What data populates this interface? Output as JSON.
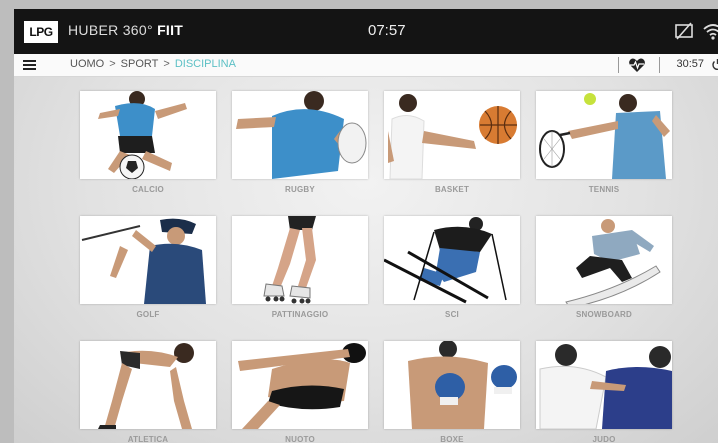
{
  "status_bar": {
    "logo": "LPG",
    "app_name_prefix": "HUBER 360°",
    "app_name_suffix": "FIIT",
    "clock": "07:57",
    "icons": [
      "no-screen-icon",
      "wifi-icon"
    ]
  },
  "nav": {
    "breadcrumb": [
      "UOMO",
      "SPORT",
      "DISCIPLINA"
    ],
    "separators": [
      ">",
      ">"
    ],
    "timer": "30:57",
    "icons": [
      "menu-icon",
      "heart-rate-icon",
      "power-icon"
    ],
    "accent_color": "#5cc0c5"
  },
  "sports": [
    {
      "id": "calcio",
      "label": "CALCIO",
      "icon": "football-player"
    },
    {
      "id": "rugby",
      "label": "RUGBY",
      "icon": "rugby-player"
    },
    {
      "id": "basket",
      "label": "BASKET",
      "icon": "basketball-player"
    },
    {
      "id": "tennis",
      "label": "TENNIS",
      "icon": "tennis-player"
    },
    {
      "id": "golf",
      "label": "GOLF",
      "icon": "golf-player"
    },
    {
      "id": "pattinaggio",
      "label": "PATTINAGGIO",
      "icon": "roller-skater"
    },
    {
      "id": "sci",
      "label": "SCI",
      "icon": "skier"
    },
    {
      "id": "snowboard",
      "label": "SNOWBOARD",
      "icon": "snowboarder"
    },
    {
      "id": "atletica",
      "label": "ATLETICA",
      "icon": "sprinter"
    },
    {
      "id": "nuoto",
      "label": "NUOTO",
      "icon": "swimmer"
    },
    {
      "id": "boxe",
      "label": "BOXE",
      "icon": "boxer"
    },
    {
      "id": "judo",
      "label": "JUDO",
      "icon": "judoka"
    }
  ]
}
